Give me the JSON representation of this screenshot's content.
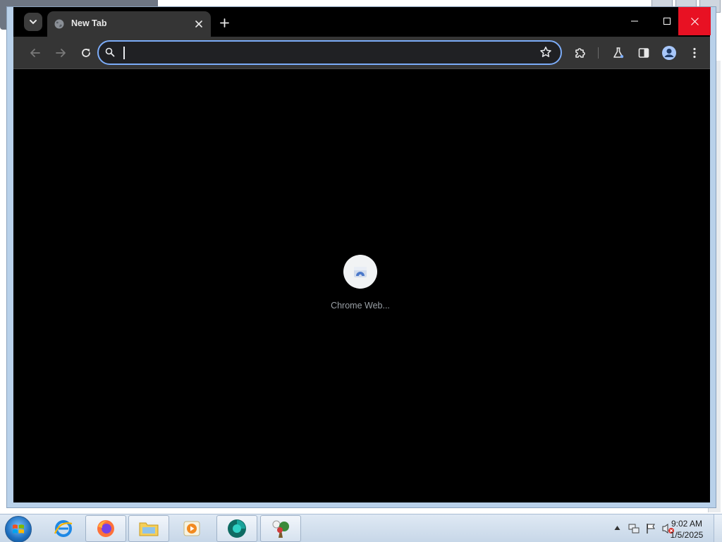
{
  "browser": {
    "tab": {
      "title": "New Tab"
    },
    "omnibox": {
      "value": "",
      "placeholder": ""
    },
    "shortcuts": [
      {
        "label": "Chrome Web..."
      }
    ],
    "colors": {
      "accent": "#7cacf8",
      "close_hover": "#e81123",
      "background": "#000000"
    }
  },
  "taskbar": {
    "apps": [
      {
        "name": "internet-explorer-icon"
      },
      {
        "name": "firefox-icon"
      },
      {
        "name": "file-explorer-icon"
      },
      {
        "name": "media-player-icon"
      },
      {
        "name": "chrome-app-icon"
      },
      {
        "name": "game-icon"
      }
    ],
    "clock": {
      "time": "9:02 AM",
      "date": "1/5/2025"
    }
  }
}
